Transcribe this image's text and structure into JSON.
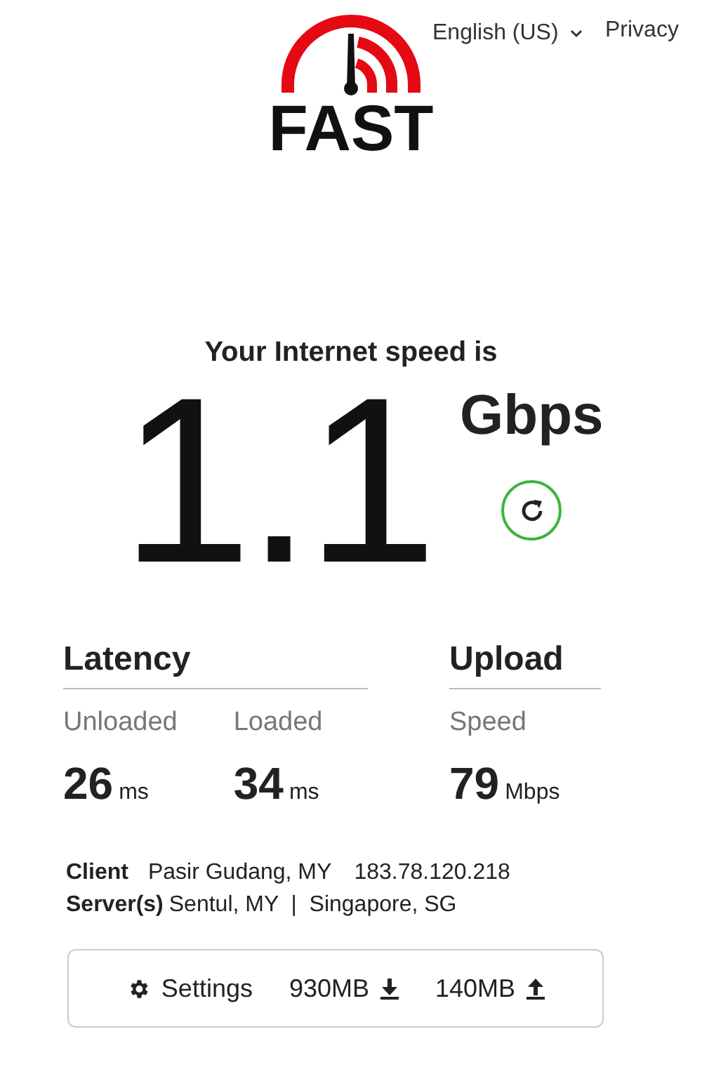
{
  "logo": {
    "text": "FAST"
  },
  "header": {
    "language": "English (US)",
    "privacy": "Privacy"
  },
  "speed": {
    "heading": "Your Internet speed is",
    "value": "1.1",
    "unit": "Gbps"
  },
  "latency": {
    "title": "Latency",
    "items": [
      {
        "label": "Unloaded",
        "value": "26",
        "unit": "ms"
      },
      {
        "label": "Loaded",
        "value": "34",
        "unit": "ms"
      }
    ]
  },
  "upload": {
    "title": "Upload",
    "items": [
      {
        "label": "Speed",
        "value": "79",
        "unit": "Mbps"
      }
    ]
  },
  "client": {
    "label": "Client",
    "location": "Pasir Gudang, MY",
    "ip": "183.78.120.218"
  },
  "servers": {
    "label": "Server(s)",
    "value": "Sentul, MY  |  Singapore, SG"
  },
  "settings": {
    "label": "Settings",
    "download": "930MB",
    "upload": "140MB"
  }
}
